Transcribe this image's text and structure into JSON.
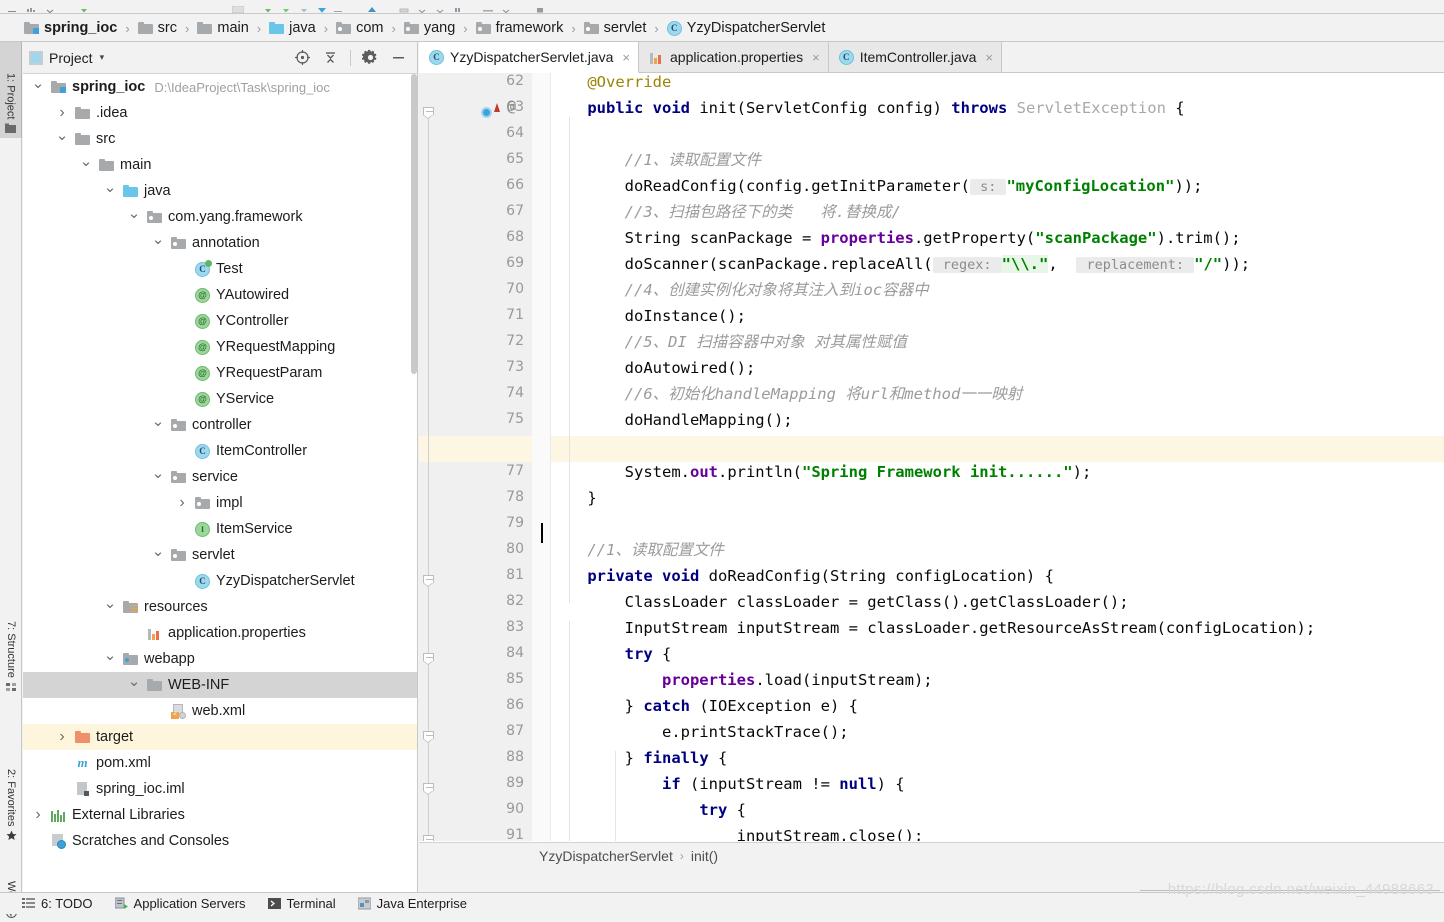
{
  "breadcrumb": {
    "items": [
      {
        "label": "spring_ioc",
        "icon": "module-folder-icon",
        "bold": true
      },
      {
        "label": "src",
        "icon": "folder-icon",
        "bold": false
      },
      {
        "label": "main",
        "icon": "folder-icon",
        "bold": false
      },
      {
        "label": "java",
        "icon": "source-folder-icon",
        "bold": false
      },
      {
        "label": "com",
        "icon": "package-icon",
        "bold": false
      },
      {
        "label": "yang",
        "icon": "package-icon",
        "bold": false
      },
      {
        "label": "framework",
        "icon": "package-icon",
        "bold": false
      },
      {
        "label": "servlet",
        "icon": "package-icon",
        "bold": false
      },
      {
        "label": "YzyDispatcherServlet",
        "icon": "class-icon",
        "bold": false
      }
    ],
    "separator": "›"
  },
  "left_strip": {
    "tabs": [
      {
        "label": "1: Project",
        "icon": "project-icon",
        "selected": true
      },
      {
        "label": "7: Structure",
        "icon": "structure-icon",
        "selected": false
      },
      {
        "label": "2: Favorites",
        "icon": "star-icon",
        "selected": false
      },
      {
        "label": "Web",
        "icon": "web-icon",
        "selected": false
      }
    ]
  },
  "project_panel": {
    "title": "Project",
    "caret": "▾",
    "actions": [
      {
        "name": "locate-icon",
        "label": "Select Opened File"
      },
      {
        "name": "collapse-all-icon",
        "label": "Collapse All"
      },
      {
        "name": "gear-icon",
        "label": "Settings"
      },
      {
        "name": "hide-icon",
        "label": "Hide"
      }
    ],
    "tree": [
      {
        "indent": 0,
        "arrow": "⌄",
        "icon": "module-folder-icon",
        "label": "spring_ioc",
        "sub": "D:\\IdeaProject\\Task\\spring_ioc",
        "bold": true,
        "state": "normal"
      },
      {
        "indent": 1,
        "arrow": "›",
        "icon": "folder-icon",
        "label": ".idea",
        "sub": "",
        "bold": false,
        "state": "normal"
      },
      {
        "indent": 1,
        "arrow": "⌄",
        "icon": "folder-icon",
        "label": "src",
        "sub": "",
        "bold": false,
        "state": "normal"
      },
      {
        "indent": 2,
        "arrow": "⌄",
        "icon": "folder-icon",
        "label": "main",
        "sub": "",
        "bold": false,
        "state": "normal"
      },
      {
        "indent": 3,
        "arrow": "⌄",
        "icon": "source-folder-icon",
        "label": "java",
        "sub": "",
        "bold": false,
        "state": "normal"
      },
      {
        "indent": 4,
        "arrow": "⌄",
        "icon": "package-icon",
        "label": "com.yang.framework",
        "sub": "",
        "bold": false,
        "state": "normal"
      },
      {
        "indent": 5,
        "arrow": "⌄",
        "icon": "package-icon",
        "label": "annotation",
        "sub": "",
        "bold": false,
        "state": "normal"
      },
      {
        "indent": 6,
        "arrow": "",
        "icon": "test-class-icon",
        "label": "Test",
        "sub": "",
        "bold": false,
        "state": "normal"
      },
      {
        "indent": 6,
        "arrow": "",
        "icon": "annotation-icon",
        "label": "YAutowired",
        "sub": "",
        "bold": false,
        "state": "normal"
      },
      {
        "indent": 6,
        "arrow": "",
        "icon": "annotation-icon",
        "label": "YController",
        "sub": "",
        "bold": false,
        "state": "normal"
      },
      {
        "indent": 6,
        "arrow": "",
        "icon": "annotation-icon",
        "label": "YRequestMapping",
        "sub": "",
        "bold": false,
        "state": "normal"
      },
      {
        "indent": 6,
        "arrow": "",
        "icon": "annotation-icon",
        "label": "YRequestParam",
        "sub": "",
        "bold": false,
        "state": "normal"
      },
      {
        "indent": 6,
        "arrow": "",
        "icon": "annotation-icon",
        "label": "YService",
        "sub": "",
        "bold": false,
        "state": "normal"
      },
      {
        "indent": 5,
        "arrow": "⌄",
        "icon": "package-icon",
        "label": "controller",
        "sub": "",
        "bold": false,
        "state": "normal"
      },
      {
        "indent": 6,
        "arrow": "",
        "icon": "class-icon",
        "label": "ItemController",
        "sub": "",
        "bold": false,
        "state": "normal"
      },
      {
        "indent": 5,
        "arrow": "⌄",
        "icon": "package-icon",
        "label": "service",
        "sub": "",
        "bold": false,
        "state": "normal"
      },
      {
        "indent": 6,
        "arrow": "›",
        "icon": "package-icon",
        "label": "impl",
        "sub": "",
        "bold": false,
        "state": "normal"
      },
      {
        "indent": 6,
        "arrow": "",
        "icon": "interface-icon",
        "label": "ItemService",
        "sub": "",
        "bold": false,
        "state": "normal"
      },
      {
        "indent": 5,
        "arrow": "⌄",
        "icon": "package-icon",
        "label": "servlet",
        "sub": "",
        "bold": false,
        "state": "normal"
      },
      {
        "indent": 6,
        "arrow": "",
        "icon": "class-icon",
        "label": "YzyDispatcherServlet",
        "sub": "",
        "bold": false,
        "state": "normal"
      },
      {
        "indent": 3,
        "arrow": "⌄",
        "icon": "resources-folder-icon",
        "label": "resources",
        "sub": "",
        "bold": false,
        "state": "normal"
      },
      {
        "indent": 4,
        "arrow": "",
        "icon": "properties-icon",
        "label": "application.properties",
        "sub": "",
        "bold": false,
        "state": "normal"
      },
      {
        "indent": 3,
        "arrow": "⌄",
        "icon": "webapp-folder-icon",
        "label": "webapp",
        "sub": "",
        "bold": false,
        "state": "normal"
      },
      {
        "indent": 4,
        "arrow": "⌄",
        "icon": "folder-icon",
        "label": "WEB-INF",
        "sub": "",
        "bold": false,
        "state": "selected"
      },
      {
        "indent": 5,
        "arrow": "",
        "icon": "xml-icon",
        "label": "web.xml",
        "sub": "",
        "bold": false,
        "state": "normal"
      },
      {
        "indent": 1,
        "arrow": "›",
        "icon": "excluded-folder-icon",
        "label": "target",
        "sub": "",
        "bold": false,
        "state": "highlight"
      },
      {
        "indent": 1,
        "arrow": "",
        "icon": "maven-icon",
        "label": "pom.xml",
        "sub": "",
        "bold": false,
        "state": "normal"
      },
      {
        "indent": 1,
        "arrow": "",
        "icon": "iml-icon",
        "label": "spring_ioc.iml",
        "sub": "",
        "bold": false,
        "state": "normal"
      },
      {
        "indent": 0,
        "arrow": "›",
        "icon": "external-libraries-icon",
        "label": "External Libraries",
        "sub": "",
        "bold": false,
        "state": "normal"
      },
      {
        "indent": 0,
        "arrow": "",
        "icon": "scratches-icon",
        "label": "Scratches and Consoles",
        "sub": "",
        "bold": false,
        "state": "normal"
      }
    ]
  },
  "editor": {
    "tabs": [
      {
        "label": "YzyDispatcherServlet.java",
        "icon": "class-icon",
        "active": true,
        "close": "×"
      },
      {
        "label": "application.properties",
        "icon": "properties-icon",
        "active": false,
        "close": "×"
      },
      {
        "label": "ItemController.java",
        "icon": "class-icon",
        "active": false,
        "close": "×"
      }
    ],
    "first_line_number": 62,
    "last_line_number": 91,
    "current_line": 76,
    "breadcrumb": [
      "YzyDispatcherServlet",
      "init()"
    ],
    "breadcrumb_sep": "›",
    "lines": [
      {
        "n": 62,
        "segs": [
          {
            "t": "    ",
            "c": ""
          },
          {
            "t": "@Override",
            "c": "anno"
          }
        ]
      },
      {
        "n": 63,
        "segs": [
          {
            "t": "    ",
            "c": ""
          },
          {
            "t": "public void ",
            "c": "kw"
          },
          {
            "t": "init(ServletConfig config) ",
            "c": ""
          },
          {
            "t": "throws ",
            "c": "kw"
          },
          {
            "t": "ServletException",
            "c": "typ"
          },
          {
            "t": " {",
            "c": ""
          }
        ]
      },
      {
        "n": 64,
        "segs": []
      },
      {
        "n": 65,
        "segs": [
          {
            "t": "        ",
            "c": ""
          },
          {
            "t": "//1、读取配置文件",
            "c": "cmt"
          }
        ]
      },
      {
        "n": 66,
        "segs": [
          {
            "t": "        doReadConfig(config.getInitParameter(",
            "c": ""
          },
          {
            "t": " s: ",
            "c": "hint"
          },
          {
            "t": "\"myConfigLocation\"",
            "c": "str"
          },
          {
            "t": "));",
            "c": ""
          }
        ]
      },
      {
        "n": 67,
        "segs": [
          {
            "t": "        ",
            "c": ""
          },
          {
            "t": "//3、扫描包路径下的类   将.替换成/",
            "c": "cmt"
          }
        ]
      },
      {
        "n": 68,
        "segs": [
          {
            "t": "        String scanPackage = ",
            "c": ""
          },
          {
            "t": "properties",
            "c": "fld"
          },
          {
            "t": ".getProperty(",
            "c": ""
          },
          {
            "t": "\"scanPackage\"",
            "c": "str"
          },
          {
            "t": ").trim();",
            "c": ""
          }
        ]
      },
      {
        "n": 69,
        "segs": [
          {
            "t": "        doScanner(scanPackage.replaceAll(",
            "c": ""
          },
          {
            "t": " regex: ",
            "c": "hint"
          },
          {
            "t": "\"\\\\.\"",
            "c": "str rxhl"
          },
          {
            "t": ",  ",
            "c": ""
          },
          {
            "t": " replacement: ",
            "c": "hint"
          },
          {
            "t": "\"/\"",
            "c": "str"
          },
          {
            "t": "));",
            "c": ""
          }
        ]
      },
      {
        "n": 70,
        "segs": [
          {
            "t": "        ",
            "c": ""
          },
          {
            "t": "//4、创建实例化对象将其注入到ioc容器中",
            "c": "cmt"
          }
        ]
      },
      {
        "n": 71,
        "segs": [
          {
            "t": "        doInstance();",
            "c": ""
          }
        ]
      },
      {
        "n": 72,
        "segs": [
          {
            "t": "        ",
            "c": ""
          },
          {
            "t": "//5、DI 扫描容器中对象 对其属性赋值",
            "c": "cmt"
          }
        ]
      },
      {
        "n": 73,
        "segs": [
          {
            "t": "        doAutowired();",
            "c": ""
          }
        ]
      },
      {
        "n": 74,
        "segs": [
          {
            "t": "        ",
            "c": ""
          },
          {
            "t": "//6、初始化handleMapping 将url和method一一映射",
            "c": "cmt"
          }
        ]
      },
      {
        "n": 75,
        "segs": [
          {
            "t": "        doHandleMapping();",
            "c": ""
          }
        ]
      },
      {
        "n": 76,
        "segs": []
      },
      {
        "n": 77,
        "segs": [
          {
            "t": "        System.",
            "c": ""
          },
          {
            "t": "out",
            "c": "stat"
          },
          {
            "t": ".println(",
            "c": ""
          },
          {
            "t": "\"Spring Framework init......\"",
            "c": "str"
          },
          {
            "t": ");",
            "c": ""
          }
        ]
      },
      {
        "n": 78,
        "segs": [
          {
            "t": "    }",
            "c": ""
          }
        ]
      },
      {
        "n": 79,
        "segs": []
      },
      {
        "n": 80,
        "segs": [
          {
            "t": "    ",
            "c": ""
          },
          {
            "t": "//1、读取配置文件",
            "c": "cmt"
          }
        ]
      },
      {
        "n": 81,
        "segs": [
          {
            "t": "    ",
            "c": ""
          },
          {
            "t": "private void ",
            "c": "kw"
          },
          {
            "t": "doReadConfig(String configLocation) {",
            "c": ""
          }
        ]
      },
      {
        "n": 82,
        "segs": [
          {
            "t": "        ClassLoader classLoader = getClass().getClassLoader();",
            "c": ""
          }
        ]
      },
      {
        "n": 83,
        "segs": [
          {
            "t": "        InputStream inputStream = classLoader.getResourceAsStream(configLocation);",
            "c": ""
          }
        ]
      },
      {
        "n": 84,
        "segs": [
          {
            "t": "        ",
            "c": ""
          },
          {
            "t": "try",
            "c": "kw"
          },
          {
            "t": " {",
            "c": ""
          }
        ]
      },
      {
        "n": 85,
        "segs": [
          {
            "t": "            ",
            "c": ""
          },
          {
            "t": "properties",
            "c": "fld"
          },
          {
            "t": ".load(inputStream);",
            "c": ""
          }
        ]
      },
      {
        "n": 86,
        "segs": [
          {
            "t": "        } ",
            "c": ""
          },
          {
            "t": "catch",
            "c": "kw"
          },
          {
            "t": " (IOException e) {",
            "c": ""
          }
        ]
      },
      {
        "n": 87,
        "segs": [
          {
            "t": "            e.printStackTrace();",
            "c": ""
          }
        ]
      },
      {
        "n": 88,
        "segs": [
          {
            "t": "        } ",
            "c": ""
          },
          {
            "t": "finally",
            "c": "kw"
          },
          {
            "t": " {",
            "c": ""
          }
        ]
      },
      {
        "n": 89,
        "segs": [
          {
            "t": "            ",
            "c": ""
          },
          {
            "t": "if",
            "c": "kw"
          },
          {
            "t": " (inputStream != ",
            "c": ""
          },
          {
            "t": "null",
            "c": "kw"
          },
          {
            "t": ") {",
            "c": ""
          }
        ]
      },
      {
        "n": 90,
        "segs": [
          {
            "t": "                ",
            "c": ""
          },
          {
            "t": "try",
            "c": "kw"
          },
          {
            "t": " {",
            "c": ""
          }
        ]
      },
      {
        "n": 91,
        "segs": [
          {
            "t": "                    inputStream.close();",
            "c": ""
          }
        ]
      }
    ]
  },
  "status_bar": {
    "items": [
      {
        "label": "6: TODO",
        "icon": "todo-icon"
      },
      {
        "label": "Application Servers",
        "icon": "app-servers-icon"
      },
      {
        "label": "Terminal",
        "icon": "terminal-icon"
      },
      {
        "label": "Java Enterprise",
        "icon": "java-enterprise-icon"
      }
    ]
  },
  "watermark": {
    "text": "https://blog.csdn.net/weixin_44988663"
  },
  "colors": {
    "accent": "#3ea2d9",
    "keyword": "#000080",
    "string": "#008000",
    "comment": "#9b9b9b",
    "field": "#660099",
    "annotation": "#9b8300",
    "selection": "#d4d4d4",
    "highlight": "#fdf6dd",
    "panel_bg": "#f2f2f2",
    "editor_bg": "#ffffff"
  }
}
